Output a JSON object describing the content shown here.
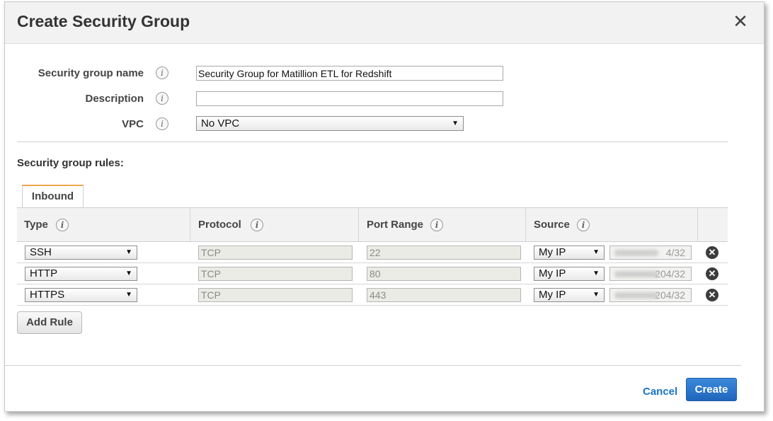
{
  "dialog": {
    "title": "Create Security Group",
    "close_glyph": "✕"
  },
  "form": {
    "name_label": "Security group name",
    "name_value": "Security Group for Matillion ETL for Redshift",
    "description_label": "Description",
    "description_value": "",
    "vpc_label": "VPC",
    "vpc_value": "No VPC"
  },
  "rules": {
    "section_label": "Security group rules:",
    "tab_label": "Inbound",
    "columns": [
      "Type",
      "Protocol",
      "Port Range",
      "Source"
    ],
    "rows": [
      {
        "type": "SSH",
        "protocol": "TCP",
        "port_range": "22",
        "source": "My IP",
        "ip_suffix": "4/32"
      },
      {
        "type": "HTTP",
        "protocol": "TCP",
        "port_range": "80",
        "source": "My IP",
        "ip_suffix": "204/32"
      },
      {
        "type": "HTTPS",
        "protocol": "TCP",
        "port_range": "443",
        "source": "My IP",
        "ip_suffix": "204/32"
      }
    ],
    "add_rule_label": "Add Rule"
  },
  "footer": {
    "cancel_label": "Cancel",
    "create_label": "Create"
  },
  "colors": {
    "primary_button": "#1f66bd",
    "link": "#1a73c8",
    "tab_accent": "#f0a64a"
  },
  "icons": {
    "info": "info-icon",
    "remove": "remove-circle-icon",
    "dropdown": "dropdown-arrow-icon",
    "close": "close-icon"
  }
}
